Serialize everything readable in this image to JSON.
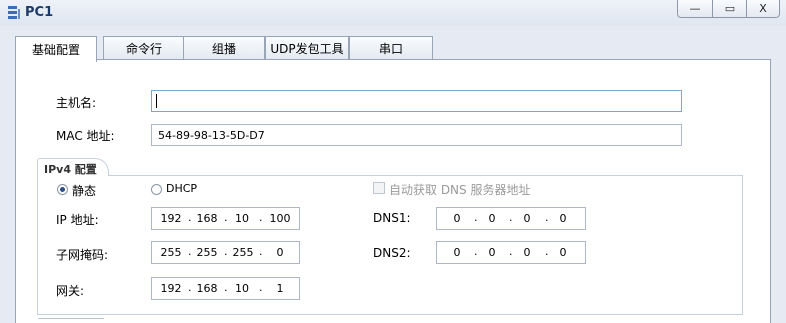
{
  "window": {
    "title": "PC1",
    "minimize_glyph": "—",
    "maximize_glyph": "▭",
    "close_glyph": "X"
  },
  "tabs": [
    {
      "label": "基础配置",
      "active": true
    },
    {
      "label": "命令行",
      "active": false
    },
    {
      "label": "组播",
      "active": false
    },
    {
      "label": "UDP发包工具",
      "active": false
    },
    {
      "label": "串口",
      "active": false
    }
  ],
  "host": {
    "hostname_label": "主机名:",
    "hostname_value": "",
    "mac_label": "MAC 地址:",
    "mac_value": "54-89-98-13-5D-D7"
  },
  "ipv4": {
    "group_title": "IPv4 配置",
    "static_label": "静态",
    "static_selected": true,
    "dhcp_label": "DHCP",
    "dhcp_selected": false,
    "auto_dns_label": "自动获取 DNS 服务器地址",
    "auto_dns_checked": false,
    "ip_label": "IP 地址:",
    "ip": [
      "192",
      "168",
      "10",
      "100"
    ],
    "mask_label": "子网掩码:",
    "mask": [
      "255",
      "255",
      "255",
      "0"
    ],
    "gateway_label": "网关:",
    "gateway": [
      "192",
      "168",
      "10",
      "1"
    ],
    "dns1_label": "DNS1:",
    "dns1": [
      "0",
      "0",
      "0",
      "0"
    ],
    "dns2_label": "DNS2:",
    "dns2": [
      "0",
      "0",
      "0",
      "0"
    ]
  },
  "icons": {
    "app": "network-pc-icon"
  },
  "colors": {
    "accent": "#1d3a66",
    "panel_bg": "#ffffff",
    "window_bg": "#e6ebf3"
  }
}
